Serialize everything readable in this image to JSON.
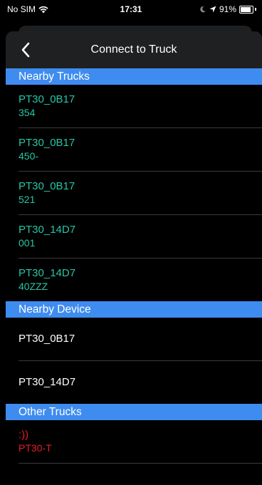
{
  "status_bar": {
    "carrier": "No SIM",
    "time": "17:31",
    "battery": "91%"
  },
  "nav": {
    "title": "Connect to Truck"
  },
  "sections": {
    "nearby_trucks": {
      "header": "Nearby Trucks",
      "items": [
        {
          "name": "PT30_0B17",
          "sub": "354"
        },
        {
          "name": "PT30_0B17",
          "sub": "450-"
        },
        {
          "name": "PT30_0B17",
          "sub": "521"
        },
        {
          "name": "PT30_14D7",
          "sub": "001"
        },
        {
          "name": "PT30_14D7",
          "sub": "40ZZZ"
        }
      ]
    },
    "nearby_device": {
      "header": "Nearby Device",
      "items": [
        {
          "name": "PT30_0B17"
        },
        {
          "name": "PT30_14D7"
        }
      ]
    },
    "other_trucks": {
      "header": "Other Trucks",
      "items": [
        {
          "name": ":))",
          "sub": "PT30-T"
        }
      ]
    }
  },
  "colors": {
    "header_bg": "#3f8cf0",
    "truck_text": "#26c6a6",
    "other_text": "#e81c28"
  }
}
